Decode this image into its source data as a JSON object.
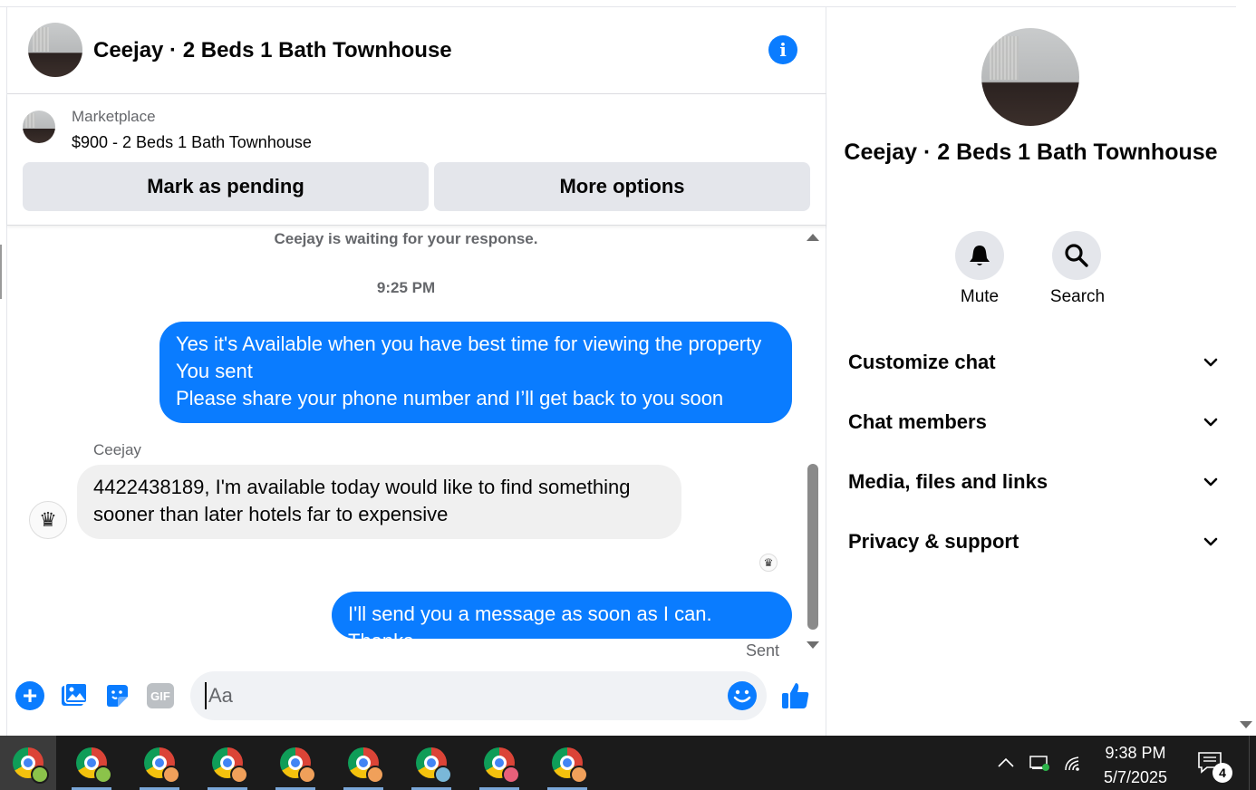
{
  "chat": {
    "title": "Ceejay · 2 Beds 1 Bath Townhouse",
    "info_icon": "info-icon"
  },
  "marketplace": {
    "label": "Marketplace",
    "listing": "$900 - 2 Beds 1 Bath Townhouse",
    "mark_pending": "Mark as pending",
    "more_options": "More options"
  },
  "messages": {
    "waiting": "Ceejay is waiting for your response.",
    "time_separator": "9:25 PM",
    "outgoing_1": [
      "Yes it's Available when you have best time for viewing the property",
      "You sent",
      "Please share your phone number and I’ll get back to you soon"
    ],
    "sender_name": "Ceejay",
    "incoming_1": [
      "4422438189, I'm available today would like to find something",
      "sooner than later hotels far to expensive"
    ],
    "outgoing_2": "I'll send you a message as soon as I can. Thanks",
    "status": "Sent"
  },
  "composer": {
    "placeholder": "Aa",
    "gif_label": "GIF",
    "accent": "#0a7cff"
  },
  "panel": {
    "title": "Ceejay · 2 Beds 1 Bath Townhouse",
    "mute_label": "Mute",
    "search_label": "Search",
    "sections": [
      "Customize chat",
      "Chat members",
      "Media, files and links",
      "Privacy & support"
    ]
  },
  "taskbar": {
    "time": "9:38 PM",
    "date": "5/7/2025",
    "notification_count": "4",
    "apps": [
      {
        "icon": "chrome-icon",
        "profile_color": "#8bc34a"
      },
      {
        "icon": "chrome-icon",
        "profile_color": "#8bc34a"
      },
      {
        "icon": "chrome-icon",
        "profile_color": "#f0a05a"
      },
      {
        "icon": "chrome-icon",
        "profile_color": "#f0a05a"
      },
      {
        "icon": "chrome-icon",
        "profile_color": "#f0a05a"
      },
      {
        "icon": "chrome-icon",
        "profile_color": "#f0a05a"
      },
      {
        "icon": "chrome-icon",
        "profile_color": "#7ab8d8"
      },
      {
        "icon": "chrome-icon",
        "profile_color": "#e8607a"
      },
      {
        "icon": "chrome-icon",
        "profile_color": "#f0a05a"
      }
    ]
  }
}
